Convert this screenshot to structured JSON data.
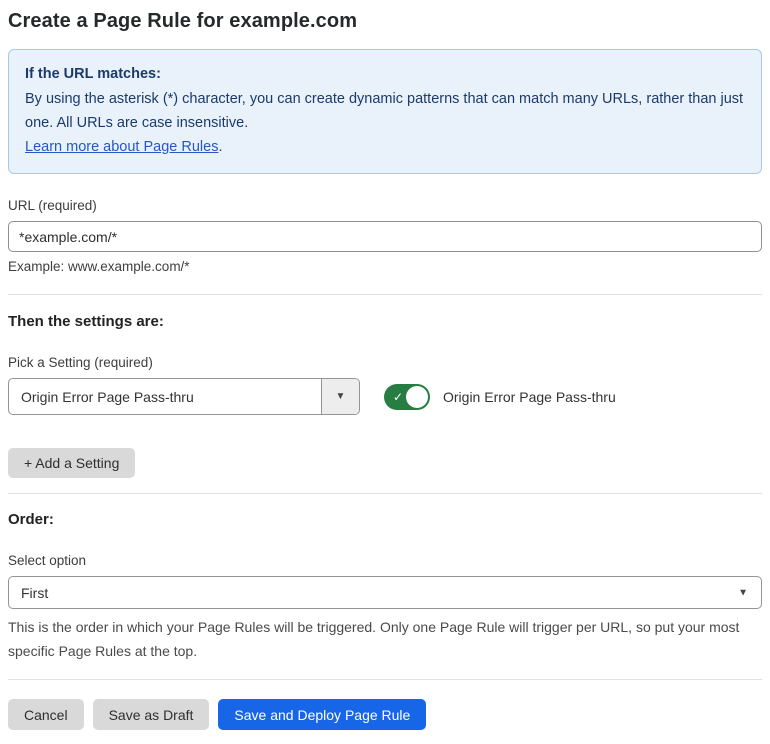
{
  "page": {
    "title": "Create a Page Rule for example.com"
  },
  "info_box": {
    "heading": "If the URL matches:",
    "body": "By using the asterisk (*) character, you can create dynamic patterns that can match many URLs, rather than just one. All URLs are case insensitive.",
    "link_text": "Learn more about Page Rules",
    "link_suffix": "."
  },
  "url_field": {
    "label": "URL (required)",
    "value": "*example.com/*",
    "helper": "Example: www.example.com/*"
  },
  "settings_section": {
    "heading": "Then the settings are:",
    "pick_label": "Pick a Setting (required)",
    "selected_setting": "Origin Error Page Pass-thru",
    "toggle_state": "on",
    "toggle_label": "Origin Error Page Pass-thru",
    "add_button_label": "+ Add a Setting"
  },
  "order_section": {
    "heading": "Order:",
    "select_label": "Select option",
    "selected_option": "First",
    "helper": "This is the order in which your Page Rules will be triggered. Only one Page Rule will trigger per URL, so put your most specific Page Rules at the top."
  },
  "footer": {
    "cancel_label": "Cancel",
    "save_draft_label": "Save as Draft",
    "save_deploy_label": "Save and Deploy Page Rule"
  },
  "icons": {
    "dropdown_caret": "▼",
    "toggle_check": "✓"
  },
  "colors": {
    "accent_blue": "#1766e8",
    "toggle_green": "#287d43",
    "info_bg": "#e9f2fb",
    "info_border": "#a9c9ea",
    "info_text": "#1b3a6b",
    "link_blue": "#2458c5"
  }
}
